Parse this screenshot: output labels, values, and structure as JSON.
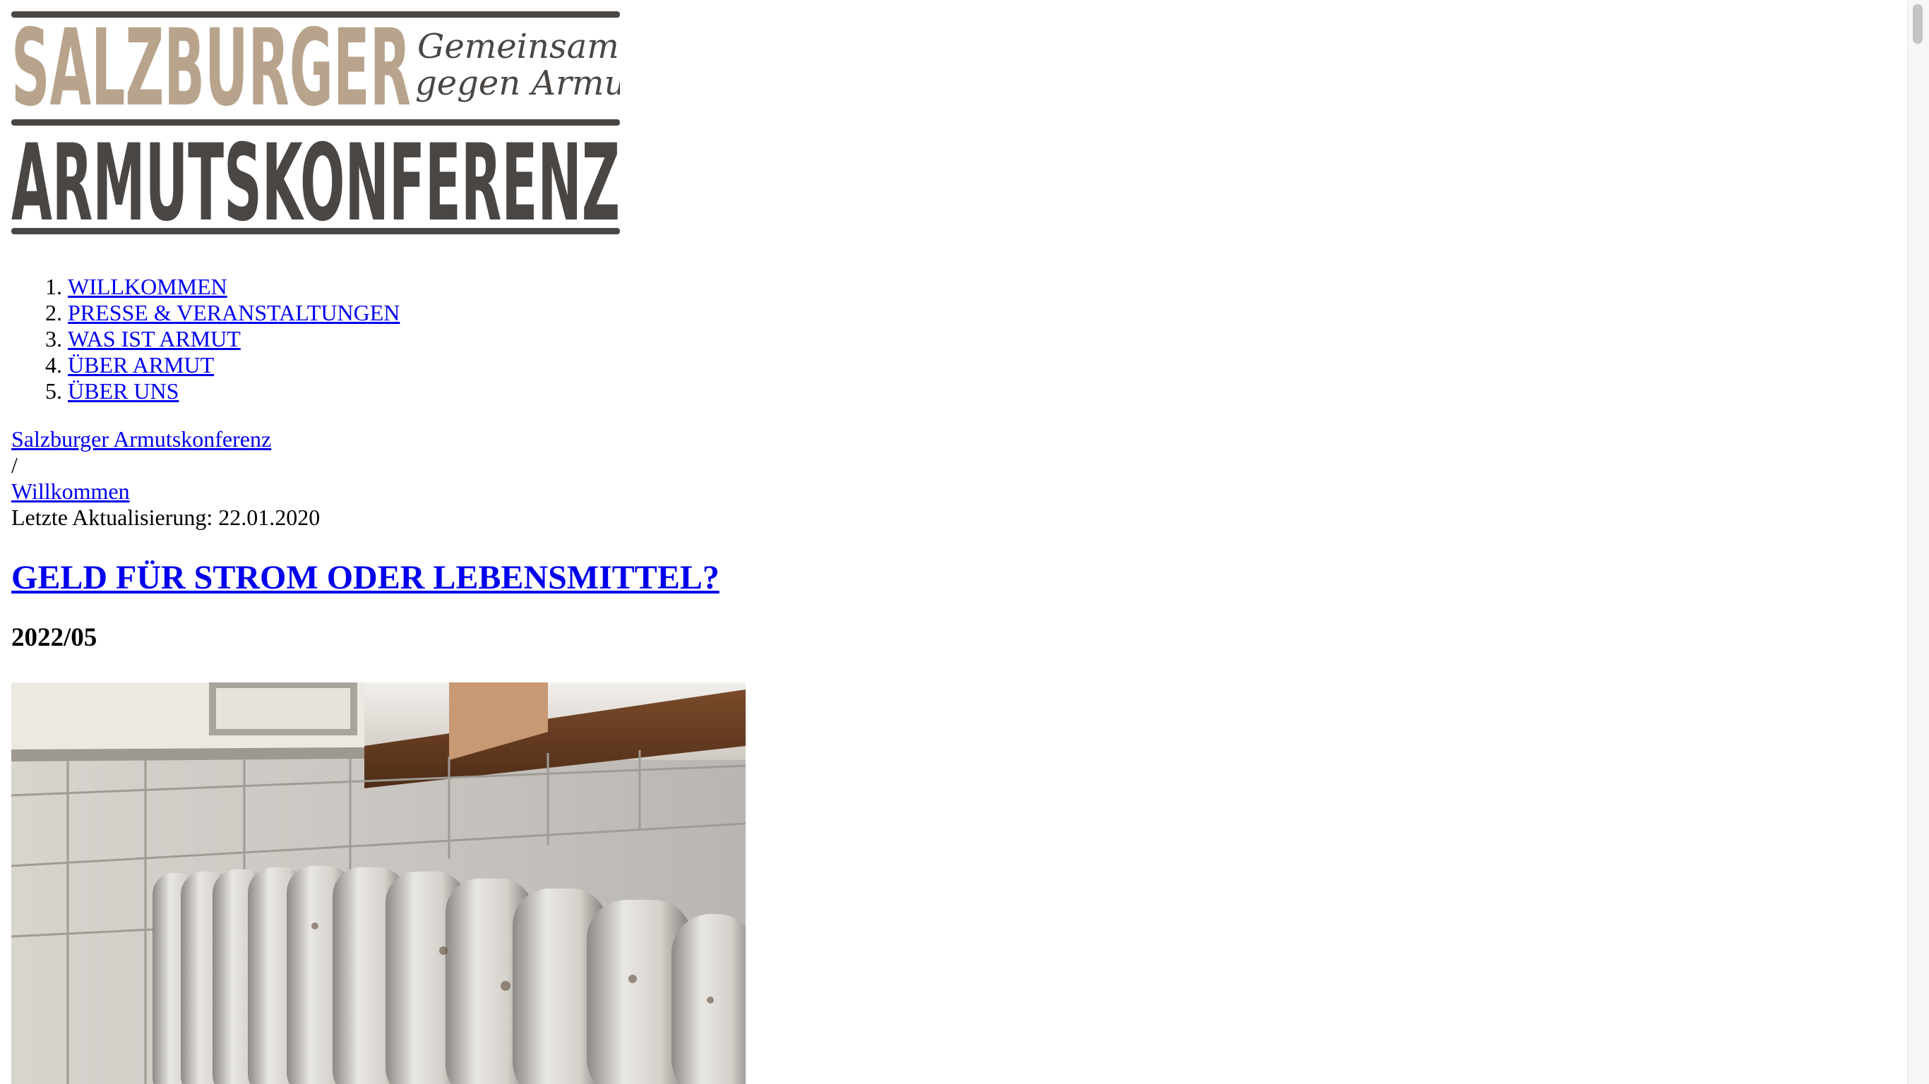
{
  "logo": {
    "line1": "SALZBURGER",
    "line2": "ARMUTSKONFERENZ",
    "tagline_1": "Gemeinsam",
    "tagline_2": "gegen Armut!",
    "color_light": "#b8a48c",
    "color_dark": "#4a4643"
  },
  "nav": {
    "items": [
      {
        "label": "WILLKOMMEN"
      },
      {
        "label": "PRESSE & VERANSTALTUNGEN"
      },
      {
        "label": "WAS IST ARMUT"
      },
      {
        "label": "ÜBER ARMUT"
      },
      {
        "label": "ÜBER UNS"
      }
    ]
  },
  "breadcrumb": {
    "home": "Salzburger Armutskonferenz",
    "separator": "/",
    "current": "Willkommen",
    "updated": "Letzte Aktualisierung: 22.01.2020"
  },
  "article": {
    "title": "GELD FÜR STROM ODER LEBENSMITTEL?",
    "date": "2022/05",
    "image_subject": "radiator-photo"
  },
  "colors": {
    "link": "#0000ee",
    "text": "#000000",
    "background": "#ffffff"
  }
}
